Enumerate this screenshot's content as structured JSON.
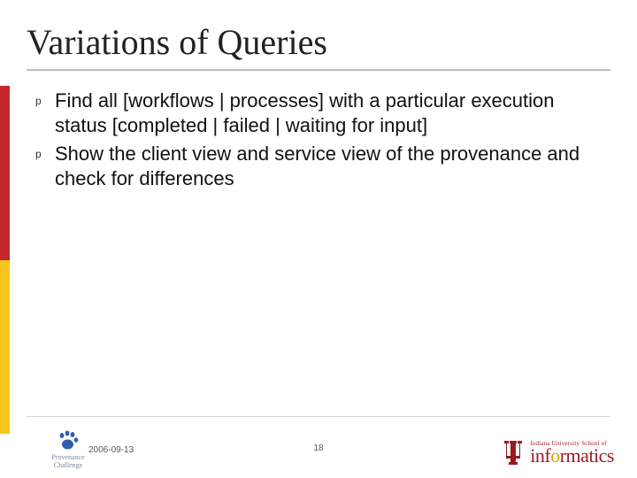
{
  "title": "Variations of Queries",
  "bullets": [
    {
      "marker": "p",
      "text": "Find all [workflows | processes] with a particular execution status [completed | failed | waiting for input]"
    },
    {
      "marker": "p",
      "text": "Show the client view and service view of the provenance and check for differences"
    }
  ],
  "footer": {
    "date": "2006-09-13",
    "page": "18",
    "provenance": {
      "line1": "Provenance",
      "line2": "Challenge"
    },
    "iu": {
      "school": "Indiana University School of",
      "word_pre": "inf",
      "word_o": "o",
      "word_post": "rmatics"
    }
  },
  "colors": {
    "crimson": "#9a1b1e",
    "gold": "#d6a400",
    "stripe_red": "#c3272b",
    "stripe_yellow": "#f5c518",
    "paw_blue": "#2f5faa"
  }
}
